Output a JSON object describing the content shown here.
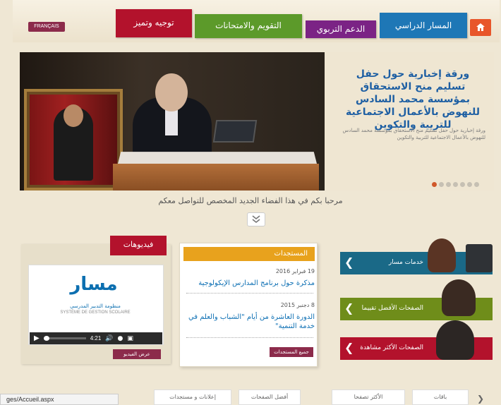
{
  "header": {
    "lang_label": "FRANÇAIS",
    "tabs": [
      "توجيه وتميز",
      "التقويم والامتحانات",
      "الدعم التربوي",
      "المسار الدراسي"
    ],
    "home_icon": "home-icon"
  },
  "slider": {
    "title": "ورقة إخبارية حول حفل تسليم منح الاستحقاق بمؤسسة محمد السادس للنهوض بالأعمال الاجتماعية للتربية والتكوين",
    "desc": "ورقة إخبارية حول حفل تسليم منح الاستحقاق بمؤسسة محمد السادس للنهوض بالأعمال الاجتماعية للتربية والتكوين",
    "dots": 7,
    "active_dot": 0
  },
  "welcome": "مرحبا بكم في هذا الفضاء الجديد المخصص للتواصل معكم",
  "videos": {
    "title": "فيديوهات",
    "logo": "مسار",
    "logo_sub": "منظومة التدبير المدرسي",
    "logo_sub_fr": "SYSTÈME DE GESTION SCOLAIRE",
    "time": "4:21",
    "button": "عرض الفيديو"
  },
  "news": {
    "title": "المستجدات",
    "items": [
      {
        "date": "19 فبراير 2016",
        "text": "مذكرة حول برنامج المدارس الإيكولوجية"
      },
      {
        "date": "8 دجنبر 2015",
        "text": "الدورة العاشرة من أيام \"الشباب والعلم في خدمة التنمية\""
      }
    ],
    "button": "جميع المستجدات"
  },
  "services": [
    {
      "label": "خدمات مسار",
      "color": "#1a6987"
    },
    {
      "label": "الصفحات الأفضل تقييما",
      "color": "#6f8d1a"
    },
    {
      "label": "الصفحات الأكثر مشاهدة",
      "color": "#b3122c"
    }
  ],
  "bottom_tabs": [
    "إعلانات و مستجدات",
    "أفضل الصفحات",
    "الأكثر تصفحا",
    "باقات"
  ],
  "status_url": "ges/Accueil.aspx"
}
